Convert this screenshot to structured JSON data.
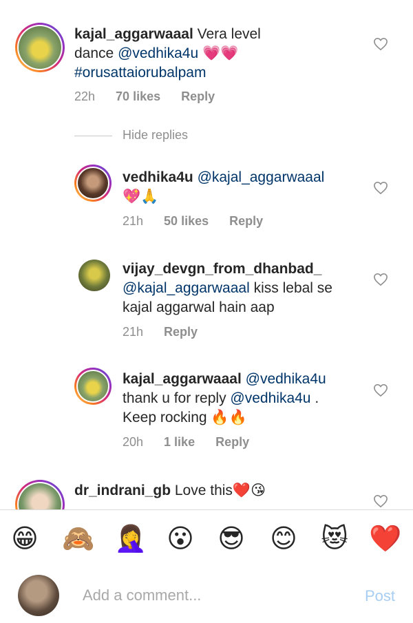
{
  "comments": [
    {
      "username": "kajal_aggarwaaal",
      "text_before": " Vera level dance ",
      "mention": "@vedhika4u",
      "emoji": "💗💗",
      "hashtag": "#orusattaiorubalpam",
      "time": "22h",
      "likes": "70 likes",
      "reply": "Reply"
    },
    {
      "username": "vedhika4u",
      "mention": "@kajal_aggarwaaal",
      "emoji": "💖🙏",
      "time": "21h",
      "likes": "50 likes",
      "reply": "Reply"
    },
    {
      "username": "vijay_devgn_from_dhanbad_",
      "mention": "@kajal_aggarwaaal",
      "text": "  kiss lebal se kajal aggarwal hain aap",
      "time": "21h",
      "reply": "Reply"
    },
    {
      "username": "kajal_aggarwaaal",
      "mention1": "@vedhika4u",
      "text": "thank u for reply ",
      "mention2": "@vedhika4u",
      "text2": " . Keep rocking ",
      "emoji": "🔥🔥",
      "time": "20h",
      "likes": "1 like",
      "reply": "Reply"
    },
    {
      "username": "dr_indrani_gb",
      "text": " Love this",
      "emoji": "❤️😘"
    }
  ],
  "hide_replies": "Hide replies",
  "emoji_bar": [
    "😁",
    "🙈",
    "🤦‍♀️",
    "😮",
    "😎",
    "😊",
    "😻",
    "❤️"
  ],
  "composer": {
    "placeholder": "Add a comment...",
    "post_label": "Post"
  },
  "colors": {
    "mention": "#003569",
    "meta": "#8e8e8e",
    "post_disabled": "#a7cdf2"
  }
}
